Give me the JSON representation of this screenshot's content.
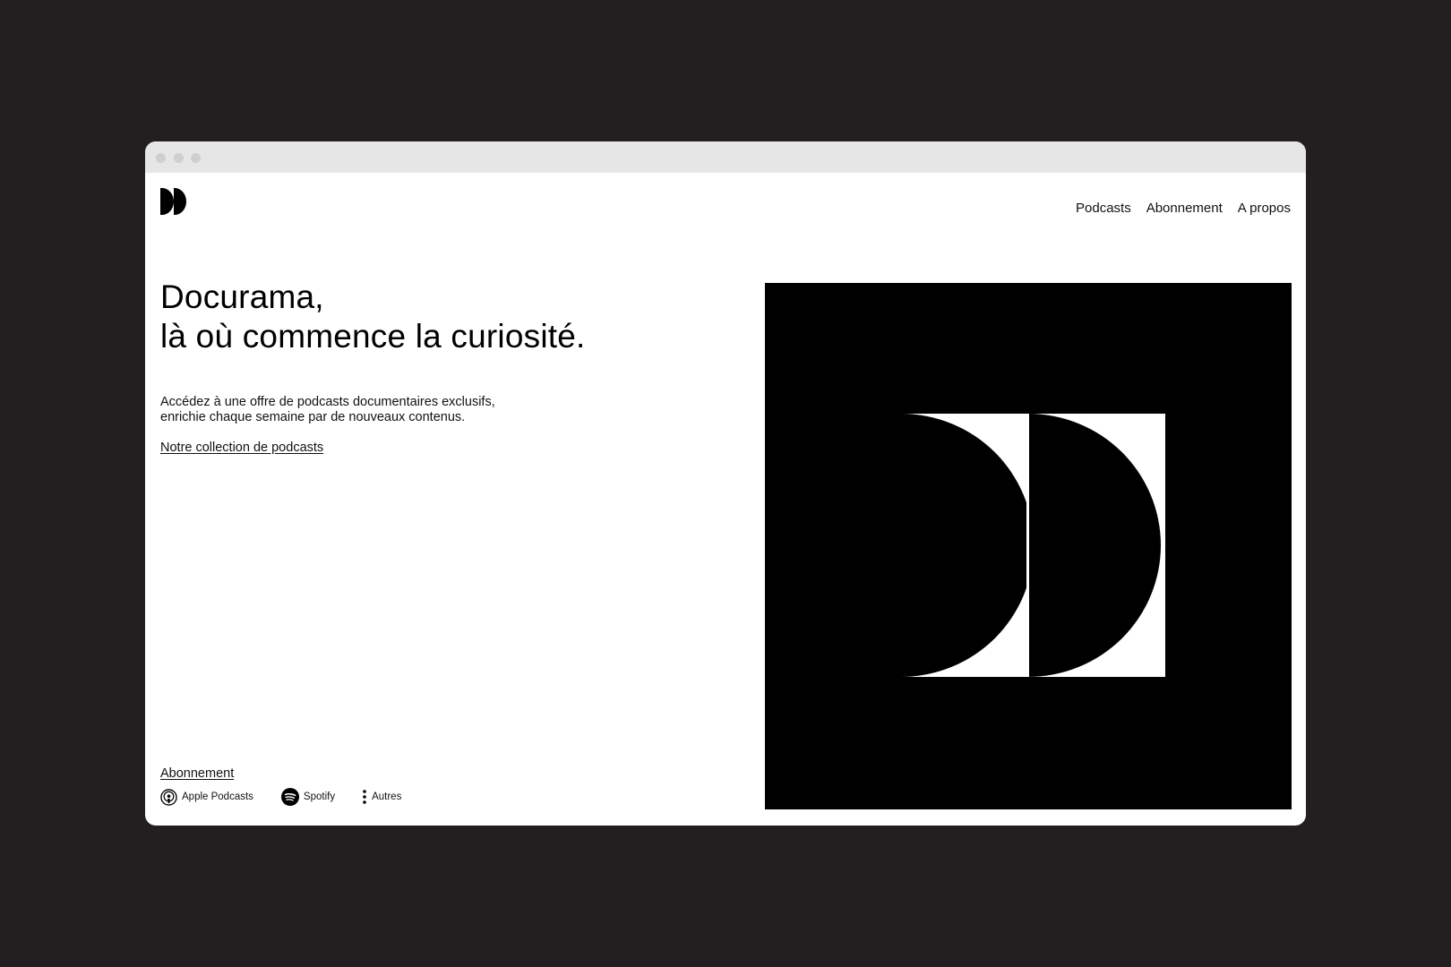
{
  "window": {
    "controls": [
      "close",
      "minimize",
      "maximize"
    ]
  },
  "header": {
    "logo_icon": "docurama-logo-icon",
    "nav": [
      {
        "label": "Podcasts"
      },
      {
        "label": "Abonnement"
      },
      {
        "label": "A propos"
      }
    ]
  },
  "hero": {
    "headline_line1": "Docurama,",
    "headline_line2": "là où commence la curiosité.",
    "intro_line1": "Accédez à une offre de podcasts documentaires exclusifs,",
    "intro_line2": "enrichie chaque semaine par de nouveaux contenus.",
    "collection_link": "Notre collection de podcasts"
  },
  "subscribe": {
    "label": "Abonnement",
    "platforms": [
      {
        "label": "Apple Podcasts",
        "icon": "apple-podcasts-icon"
      },
      {
        "label": "Spotify",
        "icon": "spotify-icon"
      },
      {
        "label": "Autres",
        "icon": "more-vertical-icon"
      }
    ]
  },
  "artwork": {
    "icon": "docurama-double-d-artwork",
    "background": "#000000",
    "foreground": "#ffffff"
  },
  "colors": {
    "page_background": "#231f20",
    "window_background": "#ffffff",
    "titlebar": "#e6e6e6",
    "text": "#111111"
  }
}
